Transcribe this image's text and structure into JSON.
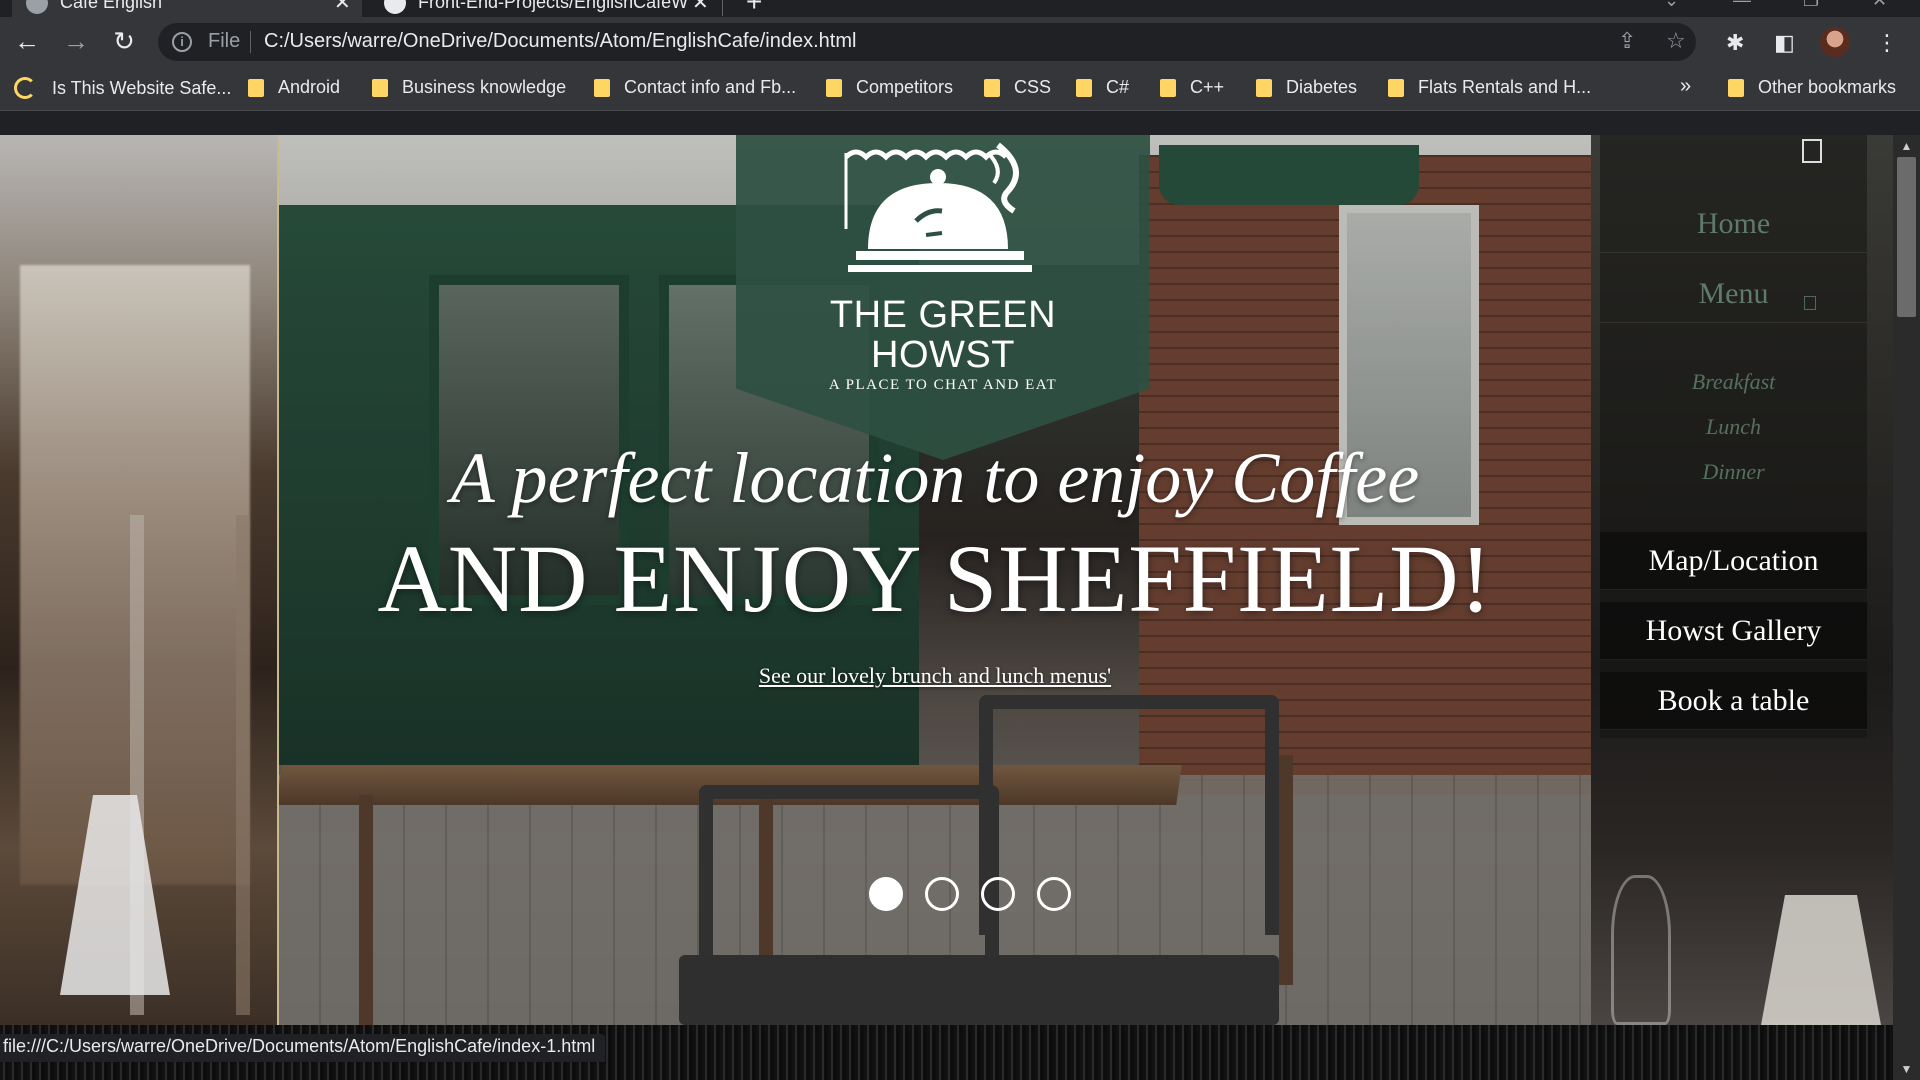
{
  "browser": {
    "tabs": [
      {
        "title": "Cafe English",
        "active": true
      },
      {
        "title": "Front-End-Projects/EnglishCafeW",
        "active": false
      }
    ],
    "new_tab_label": "+",
    "address": {
      "scheme": "File",
      "url": "C:/Users/warre/OneDrive/Documents/Atom/EnglishCafe/index.html"
    },
    "bookmarks": [
      "Is This Website Safe...",
      "Android",
      "Business knowledge",
      "Contact info and Fb...",
      "Competitors",
      "CSS",
      "C#",
      "C++",
      "Diabetes",
      "Flats Rentals and H..."
    ],
    "bookmarks_overflow": "»",
    "other_bookmarks": "Other bookmarks",
    "status_url": "file:///C:/Users/warre/OneDrive/Documents/Atom/EnglishCafe/index-1.html"
  },
  "page": {
    "brand": {
      "name_line1": "THE GREEN",
      "name_line2": "HOWST",
      "tagline": "A PLACE TO CHAT AND EAT"
    },
    "hero": {
      "line1": "A perfect location to enjoy Coffee",
      "line2": "AND ENJOY SHEFFIELD!",
      "link": "See our lovely brunch and lunch menus'"
    },
    "carousel": {
      "slides": 4,
      "active": 1
    },
    "nav": {
      "home": "Home",
      "menu": "Menu",
      "submenu": [
        "Breakfast",
        "Lunch",
        "Dinner"
      ],
      "map": "Map/Location",
      "gallery": "Howst Gallery",
      "book": "Book a table"
    }
  },
  "icons": {
    "back": "arrow-left-icon",
    "forward": "arrow-right-icon",
    "reload": "reload-icon",
    "info": "info-icon",
    "share": "share-icon",
    "star": "star-icon",
    "extensions": "puzzle-icon",
    "side_panel": "side-panel-icon",
    "menu": "kebab-menu-icon"
  },
  "colors": {
    "brand_green": "#2d5042",
    "nav_muted": "#5e7a6c",
    "folder_yellow": "#fdd663"
  }
}
